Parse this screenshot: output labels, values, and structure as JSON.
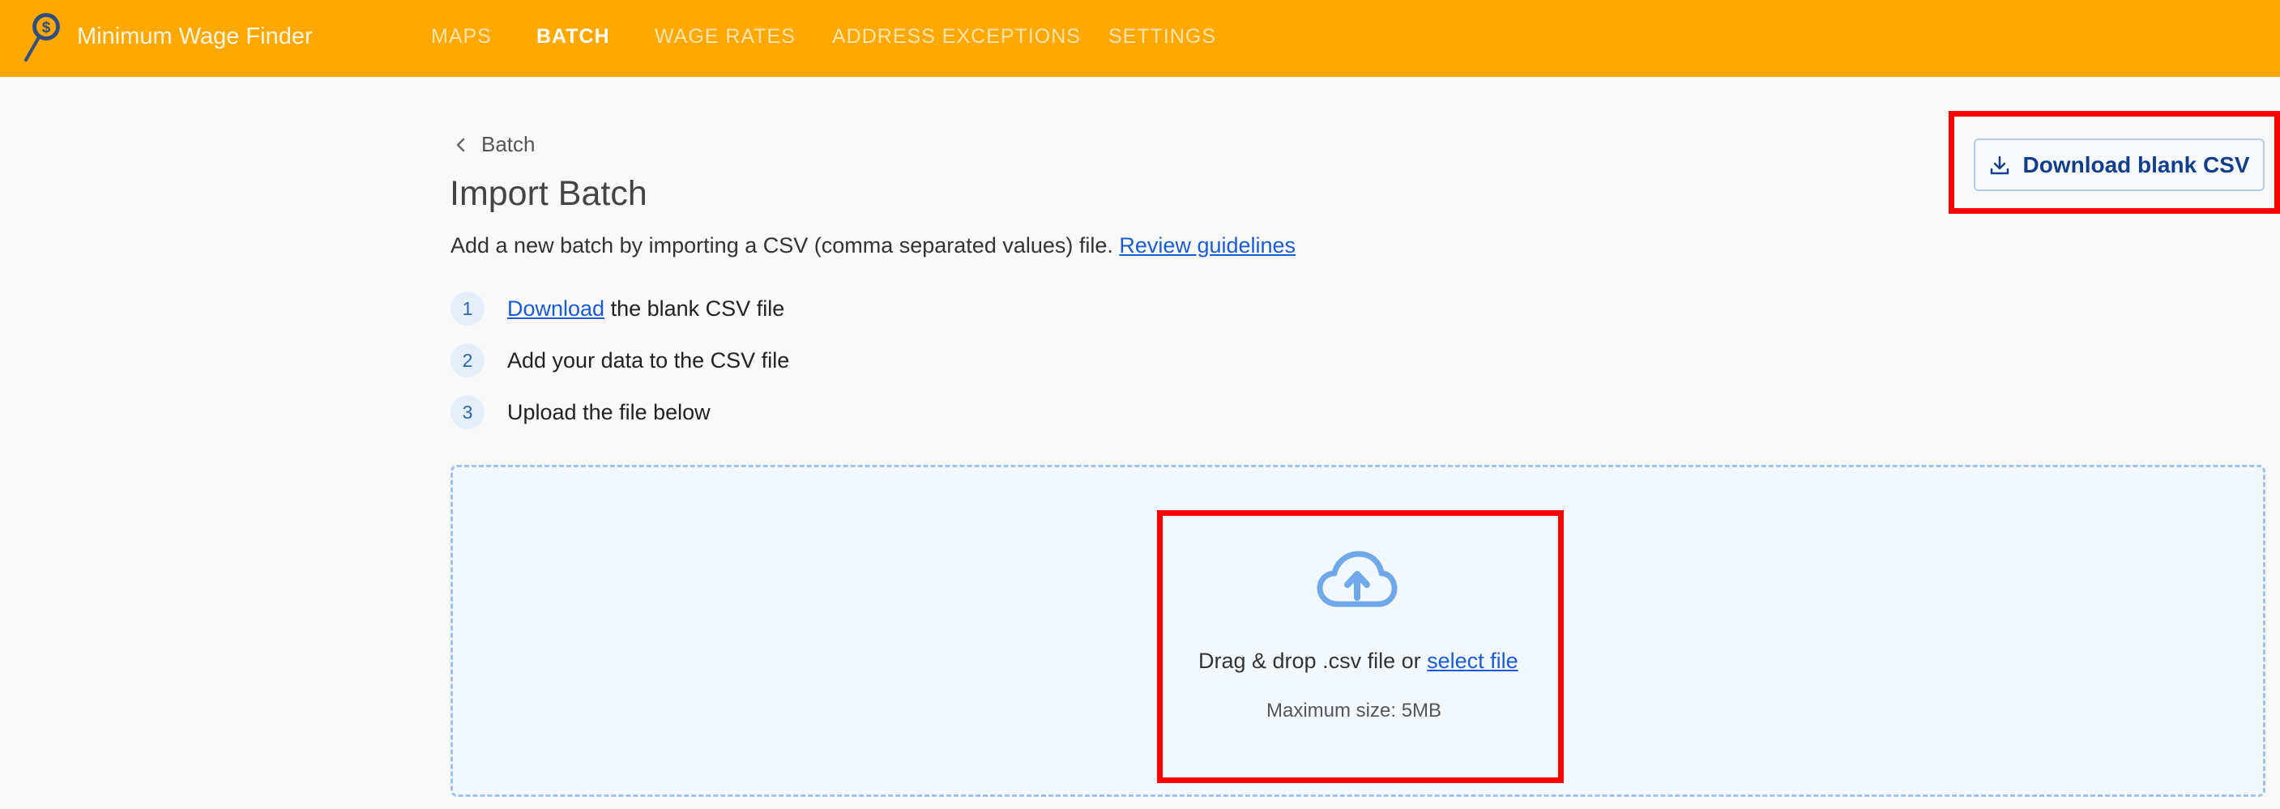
{
  "app": {
    "title": "Minimum Wage Finder",
    "logo_icon": "map-pin-dollar-icon"
  },
  "nav": {
    "items": [
      {
        "label": "MAPS",
        "active": false
      },
      {
        "label": "BATCH",
        "active": true
      },
      {
        "label": "WAGE RATES",
        "active": false
      },
      {
        "label": "ADDRESS EXCEPTIONS",
        "active": false
      },
      {
        "label": "SETTINGS",
        "active": false
      }
    ]
  },
  "breadcrumb": {
    "back_label": "Batch"
  },
  "page": {
    "title": "Import Batch",
    "description": "Add a new batch by importing a CSV (comma separated values) file.",
    "guidelines_link": "Review guidelines"
  },
  "steps": [
    {
      "number": "1",
      "link": "Download",
      "text": "the blank CSV file"
    },
    {
      "number": "2",
      "text": "Add your data to the CSV file"
    },
    {
      "number": "3",
      "text": "Upload the file below"
    }
  ],
  "actions": {
    "download_blank_csv": "Download blank CSV"
  },
  "dropzone": {
    "icon": "cloud-upload-icon",
    "text": "Drag & drop .csv file or",
    "select_link": "select file",
    "max_size": "Maximum size: 5MB"
  },
  "colors": {
    "topbar": "#ffa800",
    "link": "#1a5bd6",
    "highlight": "#ff0000",
    "dropzone_border": "#9cc4ee"
  }
}
